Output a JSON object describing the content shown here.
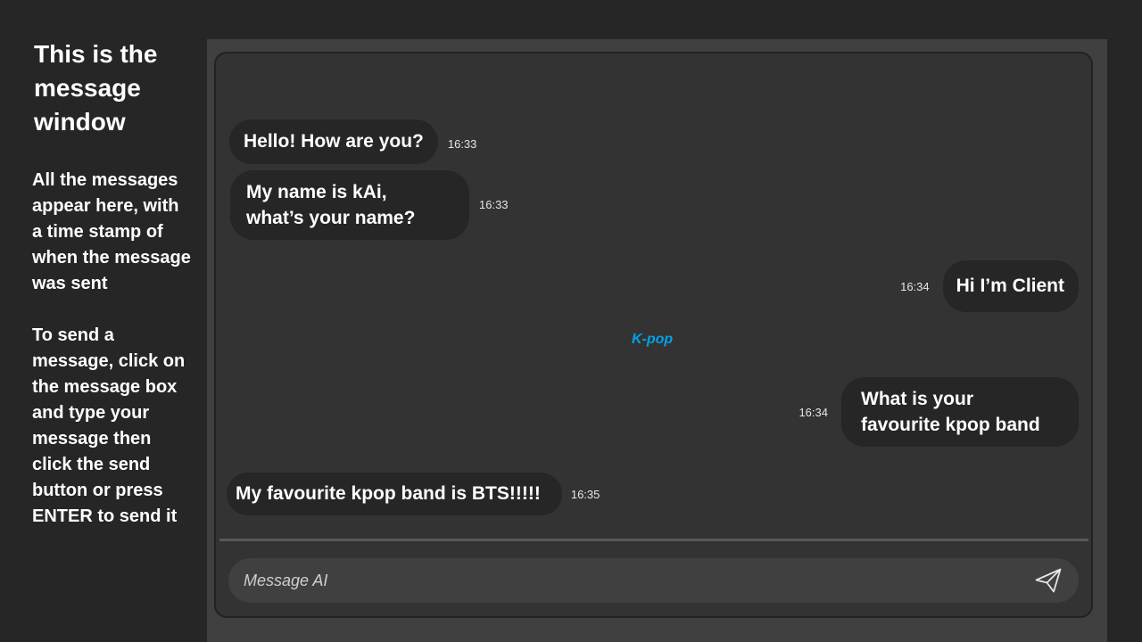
{
  "instructions": {
    "title": "This is the message window",
    "paragraph_1": "All the messages appear here, with a time stamp of when the message was sent",
    "paragraph_2": "To send a message, click on the message box and type your message then click the send button or press ENTER to send it"
  },
  "messages": [
    {
      "sender": "ai",
      "text": "Hello! How are you?",
      "time": "16:33"
    },
    {
      "sender": "ai",
      "text": "My name is kAi, what’s your name?",
      "time": "16:33"
    },
    {
      "sender": "client",
      "text": "Hi I’m Client",
      "time": "16:34"
    },
    {
      "sender": "client",
      "text": "What is your favourite kpop band",
      "time": "16:34"
    },
    {
      "sender": "ai",
      "text": "My favourite kpop band is BTS!!!!!",
      "time": "16:35"
    }
  ],
  "topic_tag": "K-pop",
  "composer": {
    "placeholder": "Message AI",
    "send_icon": "paper-plane-icon"
  },
  "colors": {
    "background": "#262626",
    "chat_background": "#333333",
    "bubble": "#262626",
    "topic_tag": "#00a2e8"
  }
}
